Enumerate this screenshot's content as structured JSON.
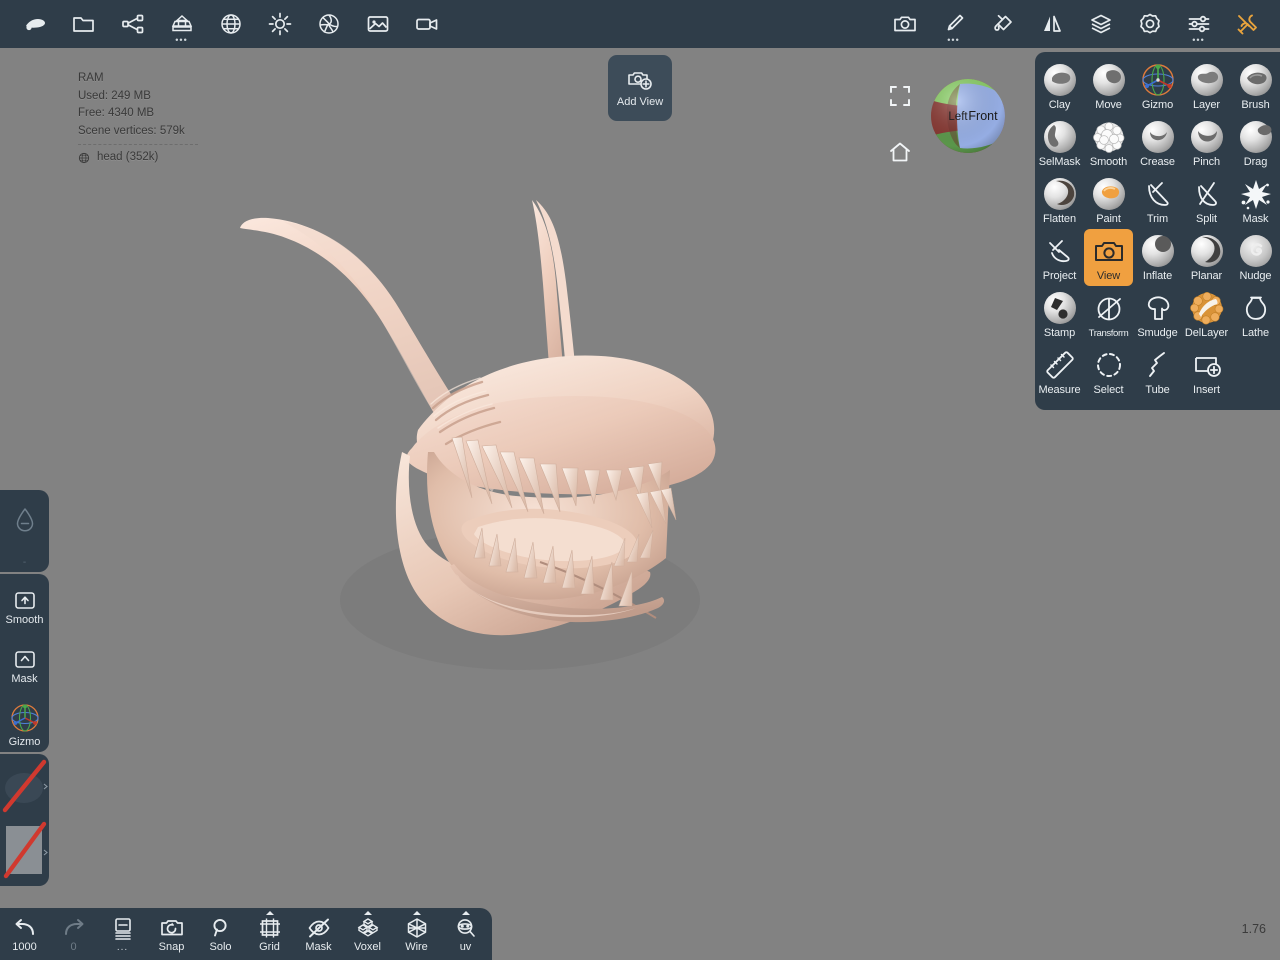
{
  "app": {
    "background_color": "#828282",
    "chrome_color": "#2f3d49",
    "accent_color": "#f0a040"
  },
  "topbar": {
    "left_items": [
      {
        "name": "sculpt-blob-icon",
        "label": "",
        "has_dots": false
      },
      {
        "name": "folder-open-icon",
        "label": "",
        "has_dots": false
      },
      {
        "name": "scene-graph-icon",
        "label": "",
        "has_dots": false
      },
      {
        "name": "multires-stack-icon",
        "label": "",
        "has_dots": true
      },
      {
        "name": "topology-sphere-icon",
        "label": "",
        "has_dots": false
      },
      {
        "name": "light-sun-icon",
        "label": "",
        "has_dots": false
      },
      {
        "name": "matcap-aperture-icon",
        "label": "",
        "has_dots": false
      },
      {
        "name": "image-background-icon",
        "label": "",
        "has_dots": false
      },
      {
        "name": "video-camera-icon",
        "label": "",
        "has_dots": false
      }
    ],
    "right_items": [
      {
        "name": "screenshot-camera-icon",
        "label": "",
        "has_dots": false
      },
      {
        "name": "brush-icon",
        "label": "",
        "has_dots": true
      },
      {
        "name": "paint-bucket-icon",
        "label": "",
        "has_dots": false
      },
      {
        "name": "symmetry-mirror-icon",
        "label": "",
        "has_dots": false
      },
      {
        "name": "layers-icon",
        "label": "",
        "has_dots": false
      },
      {
        "name": "settings-gear-icon",
        "label": "",
        "has_dots": false
      },
      {
        "name": "sliders-icon",
        "label": "",
        "has_dots": true
      },
      {
        "name": "tools-wrench-icon",
        "label": "",
        "has_dots": false
      }
    ]
  },
  "hud": {
    "ram_title": "RAM",
    "used": "Used: 249 MB",
    "free": "Free: 4340 MB",
    "vertices": "Scene vertices: 579k",
    "object": "head (352k)"
  },
  "add_view": {
    "label": "Add View",
    "icon": "add-view-camera-icon"
  },
  "view_gizmo": {
    "expand_icon": "expand-frame-icon",
    "home_icon": "home-icon",
    "face_left": "Left",
    "face_front": "Front",
    "color_left": "#8c3a34",
    "color_front": "#9db6ef",
    "color_top": "#8ed46a"
  },
  "left_sidebar": {
    "groups": [
      {
        "cells": [
          {
            "name": "intensity-drop",
            "icon": "water-drop-icon",
            "label": "",
            "sub": "-"
          }
        ]
      },
      {
        "cells": [
          {
            "name": "smooth-modifier",
            "icon": "key-up-icon",
            "label": "Smooth"
          },
          {
            "name": "mask-modifier",
            "icon": "key-shift-icon",
            "label": "Mask"
          },
          {
            "name": "gizmo-modifier",
            "icon": "gizmo-axis-icon",
            "label": "Gizmo"
          }
        ]
      },
      {
        "cells": [
          {
            "name": "alpha-slot",
            "icon": "alpha-disabled-icon",
            "label": ""
          },
          {
            "name": "stencil-slot",
            "icon": "stencil-disabled-icon",
            "label": ""
          }
        ]
      }
    ]
  },
  "bottombar": {
    "items": [
      {
        "name": "undo-button",
        "icon": "undo-arrow-icon",
        "label": "1000",
        "dim": false,
        "caret": false
      },
      {
        "name": "redo-button",
        "icon": "redo-arrow-icon",
        "label": "0",
        "dim": true,
        "caret": false
      },
      {
        "name": "history-button",
        "icon": "history-list-icon",
        "label": "...",
        "dim": false,
        "caret": false,
        "dots": true
      },
      {
        "name": "snap-toggle",
        "icon": "snap-camera-icon",
        "label": "Snap",
        "dim": false,
        "caret": false
      },
      {
        "name": "solo-toggle",
        "icon": "solo-magnifier-icon",
        "label": "Solo",
        "dim": false,
        "caret": false
      },
      {
        "name": "grid-toggle",
        "icon": "grid-frame-icon",
        "label": "Grid",
        "dim": false,
        "caret": true
      },
      {
        "name": "mask-toggle",
        "icon": "mask-eye-off-icon",
        "label": "Mask",
        "dim": false,
        "caret": false
      },
      {
        "name": "voxel-toggle",
        "icon": "voxel-cubes-icon",
        "label": "Voxel",
        "dim": false,
        "caret": true
      },
      {
        "name": "wire-toggle",
        "icon": "wireframe-icon",
        "label": "Wire",
        "dim": false,
        "caret": true
      },
      {
        "name": "uv-toggle",
        "icon": "uv-sphere-icon",
        "label": "uv",
        "dim": false,
        "caret": true
      }
    ]
  },
  "zoom_readout": "1.76",
  "tool_palette": {
    "rows": [
      [
        {
          "name": "tool-clay",
          "label": "Clay",
          "icon": "sphere-clay",
          "active": false
        },
        {
          "name": "tool-move",
          "label": "Move",
          "icon": "sphere-move",
          "active": false
        },
        {
          "name": "tool-gizmo",
          "label": "Gizmo",
          "icon": "gizmo-axis",
          "active": false
        },
        {
          "name": "tool-layer",
          "label": "Layer",
          "icon": "sphere-layer",
          "active": false
        },
        {
          "name": "tool-brush",
          "label": "Brush",
          "icon": "sphere-brush",
          "active": false
        }
      ],
      [
        {
          "name": "tool-selmask",
          "label": "SelMask",
          "icon": "sphere-selmask",
          "active": false
        },
        {
          "name": "tool-smooth",
          "label": "Smooth",
          "icon": "sphere-smooth",
          "active": false
        },
        {
          "name": "tool-crease",
          "label": "Crease",
          "icon": "sphere-crease",
          "active": false
        },
        {
          "name": "tool-pinch",
          "label": "Pinch",
          "icon": "sphere-pinch",
          "active": false
        },
        {
          "name": "tool-drag",
          "label": "Drag",
          "icon": "sphere-drag",
          "active": false
        }
      ],
      [
        {
          "name": "tool-flatten",
          "label": "Flatten",
          "icon": "sphere-flatten",
          "active": false
        },
        {
          "name": "tool-paint",
          "label": "Paint",
          "icon": "sphere-paint",
          "active": false
        },
        {
          "name": "tool-trim",
          "label": "Trim",
          "icon": "line-trim",
          "active": false
        },
        {
          "name": "tool-split",
          "label": "Split",
          "icon": "line-split",
          "active": false
        },
        {
          "name": "tool-mask",
          "label": "Mask",
          "icon": "splat-mask",
          "active": false
        }
      ],
      [
        {
          "name": "tool-project",
          "label": "Project",
          "icon": "line-project",
          "active": false
        },
        {
          "name": "tool-view",
          "label": "View",
          "icon": "camera-view",
          "active": true
        },
        {
          "name": "tool-inflate",
          "label": "Inflate",
          "icon": "sphere-inflate",
          "active": false
        },
        {
          "name": "tool-planar",
          "label": "Planar",
          "icon": "sphere-planar",
          "active": false
        },
        {
          "name": "tool-nudge",
          "label": "Nudge",
          "icon": "sphere-nudge",
          "active": false
        }
      ],
      [
        {
          "name": "tool-stamp",
          "label": "Stamp",
          "icon": "sphere-stamp",
          "active": false
        },
        {
          "name": "tool-transform",
          "label": "Transform",
          "icon": "line-transform",
          "active": false
        },
        {
          "name": "tool-smudge",
          "label": "Smudge",
          "icon": "line-smudge",
          "active": false
        },
        {
          "name": "tool-dellayer",
          "label": "DelLayer",
          "icon": "sphere-dellayer",
          "active": false
        },
        {
          "name": "tool-lathe",
          "label": "Lathe",
          "icon": "line-lathe",
          "active": false
        }
      ],
      [
        {
          "name": "tool-measure",
          "label": "Measure",
          "icon": "line-ruler",
          "active": false
        },
        {
          "name": "tool-select",
          "label": "Select",
          "icon": "line-select",
          "active": false
        },
        {
          "name": "tool-tube",
          "label": "Tube",
          "icon": "line-tube",
          "active": false
        },
        {
          "name": "tool-insert",
          "label": "Insert",
          "icon": "line-insert",
          "active": false
        }
      ]
    ]
  },
  "model": {
    "name": "head",
    "material_color": "#e8c6b4"
  }
}
